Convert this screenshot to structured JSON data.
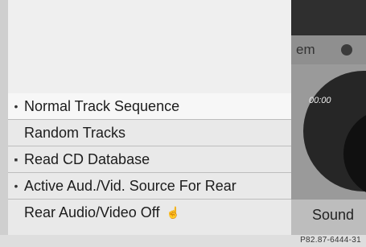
{
  "header": {
    "partial_label": "em"
  },
  "player": {
    "time": "00:00",
    "footer_label": "Sound"
  },
  "menu": {
    "items": [
      {
        "bullet": "•",
        "label": "Normal Track Sequence"
      },
      {
        "bullet": "",
        "label": "Random Tracks"
      },
      {
        "bullet": "▪",
        "label": "Read CD Database"
      },
      {
        "bullet": "•",
        "label": "Active Aud./Vid. Source For Rear"
      },
      {
        "bullet": "",
        "label": "Rear Audio/Video Off"
      }
    ]
  },
  "figure_code": "P82.87-6444-31"
}
